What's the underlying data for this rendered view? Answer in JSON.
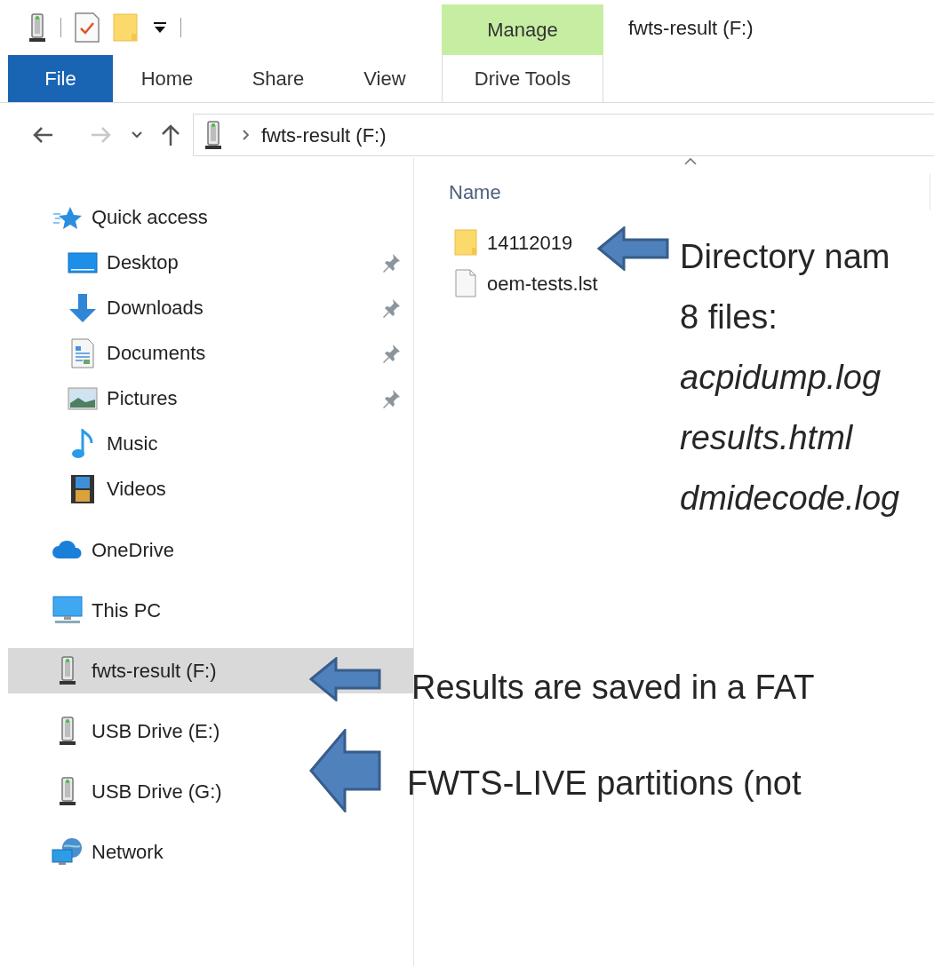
{
  "window": {
    "title": "fwts-result (F:)"
  },
  "ribbon": {
    "context_group": "Manage",
    "tabs": [
      {
        "label": "File",
        "kind": "file",
        "selected": false
      },
      {
        "label": "Home",
        "kind": "plain",
        "selected": false
      },
      {
        "label": "Share",
        "kind": "plain",
        "selected": false
      },
      {
        "label": "View",
        "kind": "plain",
        "selected": false
      },
      {
        "label": "Drive Tools",
        "kind": "contextual",
        "selected": false
      }
    ]
  },
  "address_bar": {
    "path": [
      "fwts-result (F:)"
    ]
  },
  "navigation_pane": {
    "items": [
      {
        "label": "Quick access",
        "kind": "quick-access",
        "selected": false,
        "children": [
          {
            "label": "Desktop",
            "kind": "desktop",
            "pinned": true,
            "selected": false
          },
          {
            "label": "Downloads",
            "kind": "downloads",
            "pinned": true,
            "selected": false
          },
          {
            "label": "Documents",
            "kind": "documents",
            "pinned": true,
            "selected": false
          },
          {
            "label": "Pictures",
            "kind": "pictures",
            "pinned": true,
            "selected": false
          },
          {
            "label": "Music",
            "kind": "music",
            "pinned": false,
            "selected": false
          },
          {
            "label": "Videos",
            "kind": "videos",
            "pinned": false,
            "selected": false
          }
        ]
      },
      {
        "label": "OneDrive",
        "kind": "onedrive",
        "selected": false
      },
      {
        "label": "This PC",
        "kind": "pc",
        "selected": false
      },
      {
        "label": "fwts-result (F:)",
        "kind": "drive",
        "selected": true
      },
      {
        "label": "USB Drive (E:)",
        "kind": "drive",
        "selected": false
      },
      {
        "label": "USB Drive (G:)",
        "kind": "drive",
        "selected": false
      },
      {
        "label": "Network",
        "kind": "network",
        "selected": false
      }
    ]
  },
  "file_list": {
    "columns": [
      {
        "label": "Name",
        "sorted": true
      }
    ],
    "rows": [
      {
        "name": "14112019",
        "kind": "folder"
      },
      {
        "name": "oem-tests.lst",
        "kind": "file"
      }
    ]
  },
  "annotations": [
    {
      "kind": "small-arrow",
      "lines": [
        {
          "text": "Directory nam",
          "italic": false
        },
        {
          "text": "8 files:",
          "italic": false
        },
        {
          "text": "acpidump.log",
          "italic": true
        },
        {
          "text": "results.html",
          "italic": true
        },
        {
          "text": "dmidecode.log",
          "italic": true
        }
      ]
    },
    {
      "kind": "small-arrow",
      "lines": [
        {
          "text": "Results are saved in a FAT",
          "italic": false
        }
      ]
    },
    {
      "kind": "large-arrow",
      "lines": [
        {
          "text": "FWTS-LIVE partitions (not",
          "italic": false
        }
      ]
    }
  ]
}
